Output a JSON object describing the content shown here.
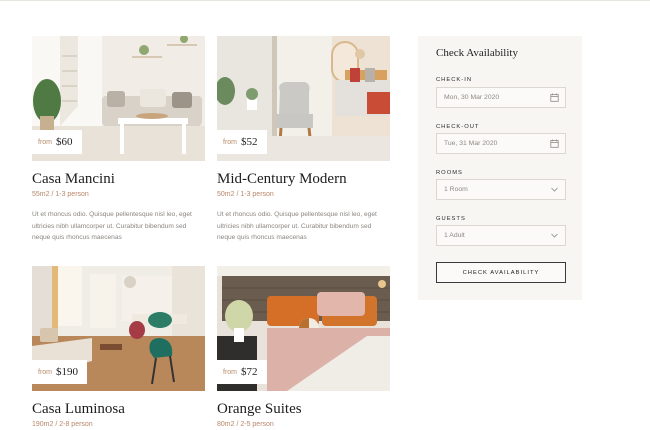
{
  "rooms": [
    {
      "price_from": "from",
      "price": "$60",
      "title": "Casa Mancini",
      "meta": "55m2 / 1-3 person",
      "description": "Ut et rhoncus odio. Quisque pellentesque nisl leo, eget ultricies nibh ullamcorper ut. Curabitur bibendum sed neque quis rhoncus maecenas"
    },
    {
      "price_from": "from",
      "price": "$52",
      "title": "Mid-Century Modern",
      "meta": "50m2 / 1-3 person",
      "description": "Ut et rhoncus odio. Quisque pellentesque nisl leo, eget ultricies nibh ullamcorper ut. Curabitur bibendum sed neque quis rhoncus maecenas"
    },
    {
      "price_from": "from",
      "price": "$190",
      "title": "Casa Luminosa",
      "meta": "190m2 / 2-8 person"
    },
    {
      "price_from": "from",
      "price": "$72",
      "title": "Orange Suites",
      "meta": "80m2 / 2-5 person"
    }
  ],
  "booking": {
    "title": "Check Availability",
    "checkin_label": "CHECK-IN",
    "checkin_value": "Mon, 30 Mar 2020",
    "checkout_label": "CHECK-OUT",
    "checkout_value": "Tue, 31 Mar 2020",
    "rooms_label": "ROOMS",
    "rooms_value": "1 Room",
    "guests_label": "GUESTS",
    "guests_value": "1 Adult",
    "button_label": "CHECK AVAILABILITY"
  },
  "icons": {
    "calendar": "calendar-icon",
    "chevron": "chevron-down-icon"
  },
  "colors": {
    "accent": "#b8876a",
    "panel_bg": "#f8f6f3",
    "field_border": "#dcd7d1"
  }
}
